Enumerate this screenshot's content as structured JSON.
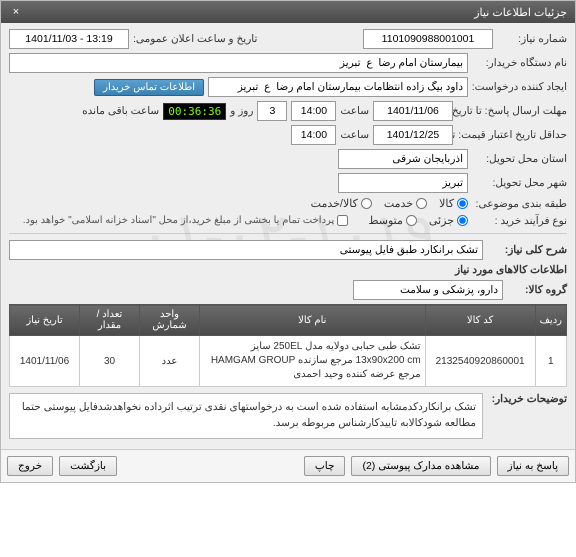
{
  "panel": {
    "title": "جزئیات اطلاعات نیاز",
    "close": "×"
  },
  "watermark": "١٠١٩-٠٢-٠١",
  "form": {
    "need_no_label": "شماره نیاز:",
    "need_no": "1101090988001001",
    "announce_label": "تاریخ و ساعت اعلان عمومی:",
    "announce_value": "1401/11/03 - 13:19",
    "buyer_label": "نام دستگاه خریدار:",
    "buyer": "بیمارستان امام رضا  ع  تبریز",
    "requester_label": "ایجاد کننده درخواست:",
    "requester": "داود بیگ زاده انتظامات بیمارستان امام رضا  ع  تبریز",
    "contact_btn": "اطلاعات تماس خریدار",
    "deadline_label": "مهلت ارسال پاسخ: تا تاریخ:",
    "deadline_date": "1401/11/06",
    "time_label": "ساعت",
    "deadline_time": "14:00",
    "days_remaining": "3",
    "days_text": "روز و",
    "countdown": "00:36:36",
    "remaining_text": "ساعت باقی مانده",
    "validity_label": "حداقل تاریخ اعتبار قیمت: تا تاریخ:",
    "validity_date": "1401/12/25",
    "validity_time": "14:00",
    "province_label": "استان محل تحویل:",
    "province": "آذربایجان شرقی",
    "city_label": "شهر محل تحویل:",
    "city": "تبریز",
    "category_label": "طبقه بندی موضوعی:",
    "cat_goods": "کالا",
    "cat_service": "خدمت",
    "cat_goods_service": "کالا/خدمت",
    "process_label": "نوع فرآیند خرید :",
    "proc_small": "جزئی",
    "proc_medium": "متوسط",
    "proc_note": "پرداخت تمام یا بخشی از مبلغ خرید،از محل \"اسناد خزانه اسلامی\" خواهد بود.",
    "summary_label": "شرح کلی نیاز:",
    "summary": "تشک برانکارد طبق فایل پیوستی",
    "goods_section": "اطلاعات کالاهای مورد نیاز",
    "group_label": "گروه کالا:",
    "group": "دارو، پزشکی و سلامت",
    "buyer_notes_label": "توضیحات خریدار:",
    "buyer_notes": "تشک برانکاردکدمشابه استفاده شده است به درخواستهای نقدی ترتیب اثرداده نخواهدشدفایل پیوستی حتما مطالعه شودکالابه تاییدکارشناس مربوطه برسد."
  },
  "table": {
    "headers": {
      "row": "ردیف",
      "code": "کد کالا",
      "name": "نام کالا",
      "unit": "واحد شمارش",
      "qty": "تعداد / مقدار",
      "date": "تاریخ نیاز"
    },
    "rows": [
      {
        "idx": "1",
        "code": "2132540920860001",
        "name": "تشک طبی حبابی دولایه مدل 250EL سایز 13x90x200 cm مرجع سازنده HAMGAM GROUP مرجع عرضه کننده وحید احمدی",
        "unit": "عدد",
        "qty": "30",
        "date": "1401/11/06"
      }
    ]
  },
  "footer": {
    "respond": "پاسخ به نیاز",
    "attachments": "مشاهده مدارک پیوستی (2)",
    "print": "چاپ",
    "back": "بازگشت",
    "exit": "خروج"
  }
}
